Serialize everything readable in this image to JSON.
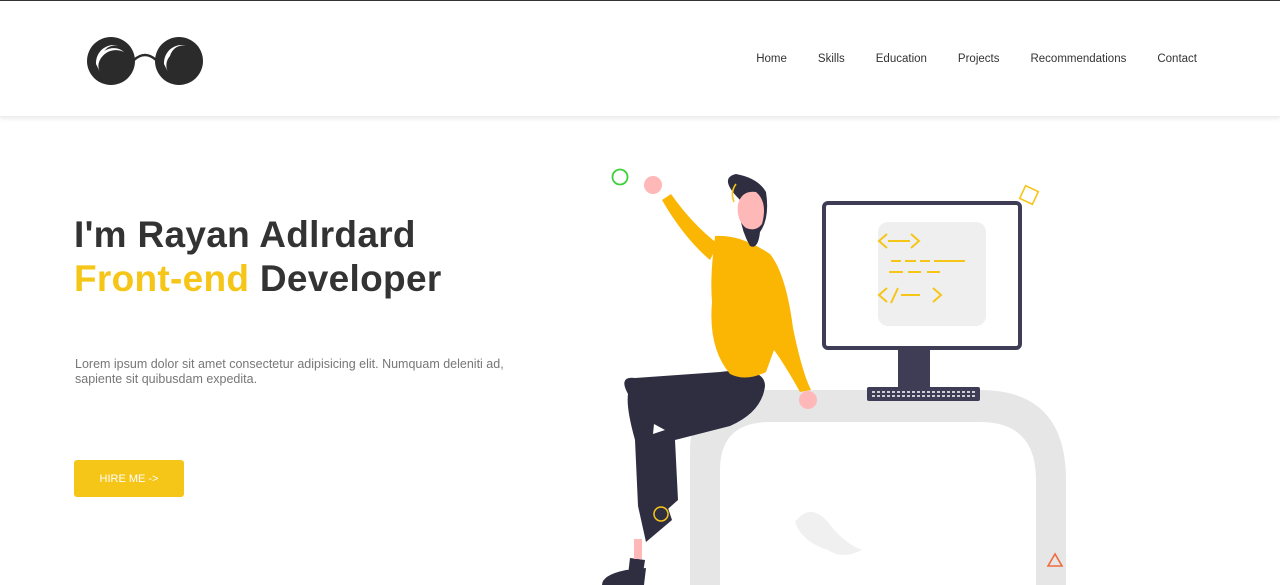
{
  "brand": {
    "logo_icon": "glasses-icon"
  },
  "nav": {
    "items": [
      {
        "label": "Home"
      },
      {
        "label": "Skills"
      },
      {
        "label": "Education"
      },
      {
        "label": "Projects"
      },
      {
        "label": "Recommendations"
      },
      {
        "label": "Contact"
      }
    ]
  },
  "hero": {
    "greeting": "I'm Rayan Adlrdard",
    "role_accent": "Front-end",
    "role_rest": " Developer",
    "description": "Lorem ipsum dolor sit amet consectetur adipisicing elit. Numquam deleniti ad, sapiente sit quibusdam expedita.",
    "cta_label": "HIRE ME ->",
    "illustration": "developer-at-monitor-illustration"
  },
  "colors": {
    "accent": "#f5c518",
    "text": "#333333",
    "muted": "#777777",
    "dark": "#2f2e41"
  }
}
